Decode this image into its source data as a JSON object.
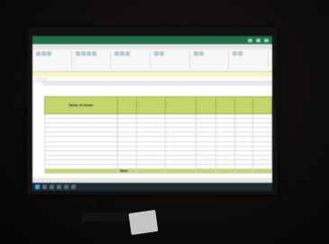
{
  "window": {
    "title": ""
  },
  "ribbon_tabs": [
    "",
    "",
    "",
    "",
    "",
    "",
    ""
  ],
  "info_bar": {
    "text": ""
  },
  "table": {
    "headers": [
      "Name of issuer",
      "",
      "",
      "",
      "",
      "",
      "",
      ""
    ],
    "rows": [
      [
        "",
        "",
        "",
        "",
        "",
        "",
        "",
        ""
      ],
      [
        "",
        "",
        "",
        "",
        "",
        "",
        "",
        ""
      ],
      [
        "",
        "",
        "",
        "",
        "",
        "",
        "",
        ""
      ],
      [
        "",
        "",
        "",
        "",
        "",
        "",
        "",
        ""
      ],
      [
        "",
        "",
        "",
        "",
        "",
        "",
        "",
        ""
      ],
      [
        "",
        "",
        "",
        "",
        "",
        "",
        "",
        ""
      ],
      [
        "",
        "",
        "",
        "",
        "",
        "",
        "",
        ""
      ],
      [
        "",
        "",
        "",
        "",
        "",
        "",
        "",
        ""
      ],
      [
        "",
        "",
        "",
        "",
        "",
        "",
        "",
        ""
      ],
      [
        "",
        "",
        "",
        "",
        "",
        "",
        "",
        ""
      ],
      [
        "",
        "",
        "",
        "",
        "",
        "",
        "",
        ""
      ],
      [
        "",
        "",
        "",
        "",
        "",
        "",
        "",
        ""
      ]
    ],
    "total_label": "Total"
  },
  "sheet_tabs": [
    ""
  ],
  "accent_colors": {
    "excel_green": "#1e7145",
    "header_fill": "#c3d66a",
    "info_bar": "#fff2b8"
  }
}
